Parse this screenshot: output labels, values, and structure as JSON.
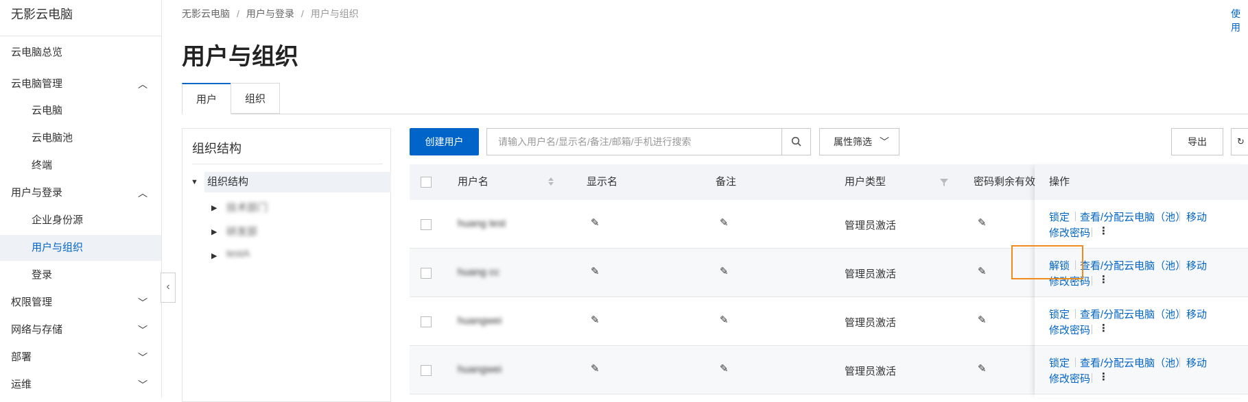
{
  "app": {
    "title": "无影云电脑"
  },
  "sidebar": {
    "items": [
      {
        "label": "云电脑总览"
      },
      {
        "label": "云电脑管理",
        "chevron": "up"
      },
      {
        "label": "云电脑"
      },
      {
        "label": "云电脑池"
      },
      {
        "label": "终端"
      },
      {
        "label": "用户与登录",
        "chevron": "up"
      },
      {
        "label": "企业身份源"
      },
      {
        "label": "用户与组织",
        "active": true
      },
      {
        "label": "登录"
      },
      {
        "label": "权限管理",
        "chevron": "down"
      },
      {
        "label": "网络与存储",
        "chevron": "down"
      },
      {
        "label": "部署",
        "chevron": "down"
      },
      {
        "label": "运维",
        "chevron": "down"
      }
    ]
  },
  "breadcrumb": [
    "无影云电脑",
    "用户与登录",
    "用户与组织"
  ],
  "top_right_link": "使用",
  "page_title": "用户与组织",
  "tabs": [
    {
      "label": "用户",
      "active": true
    },
    {
      "label": "组织"
    }
  ],
  "org_panel": {
    "title": "组织结构",
    "root": "组织结构",
    "children": [
      "技术部门",
      "研发部",
      "testA"
    ]
  },
  "toolbar": {
    "create_user": "创建用户",
    "search_placeholder": "请输入用户名/显示名/备注/邮箱/手机进行搜索",
    "filter_label": "属性筛选",
    "export_label": "导出"
  },
  "table": {
    "columns": [
      "用户名",
      "显示名",
      "备注",
      "用户类型",
      "密码剩余有效",
      "操作"
    ],
    "rows": [
      {
        "username": "huang test",
        "user_type": "管理员激活",
        "lock_action": "锁定"
      },
      {
        "username": "huang cc",
        "user_type": "管理员激活",
        "lock_action": "解锁"
      },
      {
        "username": "huangwei",
        "user_type": "管理员激活",
        "lock_action": "锁定"
      },
      {
        "username": "huangwei",
        "user_type": "管理员激活",
        "lock_action": "锁定"
      }
    ],
    "actions": {
      "view_assign": "查看/分配云电脑（池）",
      "move": "移动",
      "change_password": "修改密码",
      "more": "⋮"
    }
  },
  "colors": {
    "accent": "#0064c8",
    "highlight": "#f08a1a"
  }
}
